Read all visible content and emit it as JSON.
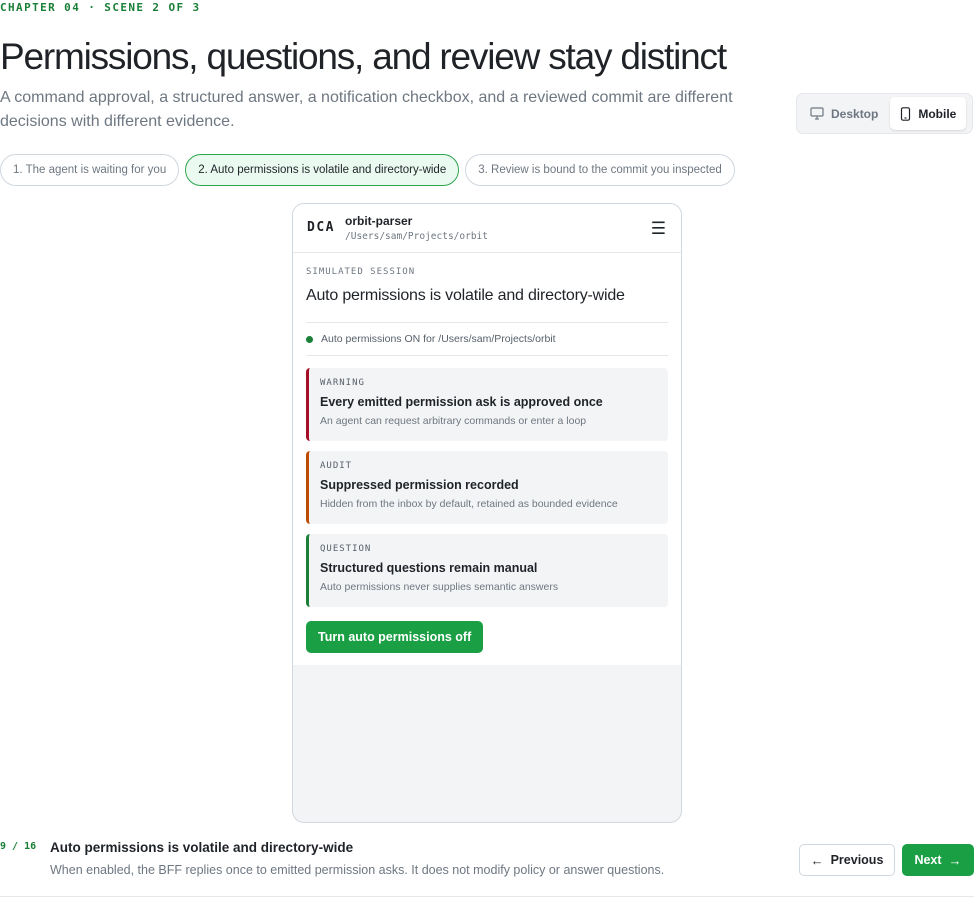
{
  "header": {
    "eyebrow": "CHAPTER 04 · SCENE 2 OF 3",
    "title": "Permissions, questions, and review stay distinct",
    "subtitle": "A command approval, a structured answer, a notification checkbox, and a reviewed commit are different decisions with different evidence."
  },
  "view_toggle": {
    "options": [
      {
        "label": "Desktop",
        "icon": "desktop-icon",
        "active": false
      },
      {
        "label": "Mobile",
        "icon": "mobile-icon",
        "active": true
      }
    ]
  },
  "steps": [
    {
      "label": "1. The agent is waiting for you",
      "active": false
    },
    {
      "label": "2. Auto permissions is volatile and directory-wide",
      "active": true
    },
    {
      "label": "3. Review is bound to the commit you inspected",
      "active": false
    }
  ],
  "phone": {
    "logo": "DCA",
    "project_name": "orbit-parser",
    "project_path": "/Users/sam/Projects/orbit",
    "menu_icon": "hamburger-menu-icon",
    "session_label": "SIMULATED SESSION",
    "session_title": "Auto permissions is volatile and directory-wide",
    "status": "Auto permissions ON for /Users/sam/Projects/orbit",
    "cards": [
      {
        "kind": "WARNING",
        "title": "Every emitted permission ask is approved once",
        "desc": "An agent can request arbitrary commands or enter a loop",
        "accent": "#a40e26"
      },
      {
        "kind": "AUDIT",
        "title": "Suppressed permission recorded",
        "desc": "Hidden from the inbox by default, retained as bounded evidence",
        "accent": "#bc4c00"
      },
      {
        "kind": "QUESTION",
        "title": "Structured questions remain manual",
        "desc": "Auto permissions never supplies semantic answers",
        "accent": "#1a7f37"
      }
    ],
    "primary_action": "Turn auto permissions off"
  },
  "footer": {
    "counter": "9 / 16",
    "title": "Auto permissions is volatile and directory-wide",
    "description": "When enabled, the BFF replies once to emitted permission asks. It does not modify policy or answer questions.",
    "previous_label": "Previous",
    "next_label": "Next"
  },
  "colors": {
    "accent_green": "#1a7f37",
    "button_green": "#1a9f45",
    "warning_red": "#a40e26",
    "audit_orange": "#bc4c00"
  }
}
